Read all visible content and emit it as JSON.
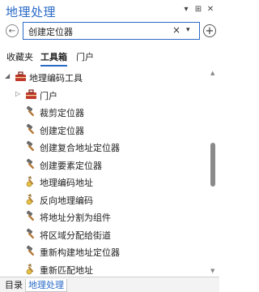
{
  "window": {
    "title": "地理处理",
    "options_icon": "▾",
    "pin_icon": "⊞",
    "close_icon": "✕"
  },
  "search": {
    "value": "创建定位器",
    "clear": "×",
    "dropdown": "▾"
  },
  "tabs": [
    {
      "label": "收藏夹",
      "active": false
    },
    {
      "label": "工具箱",
      "active": true
    },
    {
      "label": "门户",
      "active": false
    }
  ],
  "tree": [
    {
      "label": "地理编码工具",
      "icon": "toolbox-icon",
      "level": 0,
      "arrow": "◢"
    },
    {
      "label": "门户",
      "icon": "toolbox-icon",
      "level": 1,
      "arrow": "▷"
    },
    {
      "label": "裁剪定位器",
      "icon": "hammer-icon",
      "level": 2
    },
    {
      "label": "创建定位器",
      "icon": "hammer-icon",
      "level": 2
    },
    {
      "label": "创建复合地址定位器",
      "icon": "hammer-icon",
      "level": 2
    },
    {
      "label": "创建要素定位器",
      "icon": "hammer-icon",
      "level": 2
    },
    {
      "label": "地理编码地址",
      "icon": "geocode-icon",
      "level": 2
    },
    {
      "label": "反向地理编码",
      "icon": "geocode-icon",
      "level": 2
    },
    {
      "label": "将地址分割为组件",
      "icon": "hammer-icon",
      "level": 2
    },
    {
      "label": "将区域分配给街道",
      "icon": "hammer-icon",
      "level": 2
    },
    {
      "label": "重新构建地址定位器",
      "icon": "hammer-icon",
      "level": 2
    },
    {
      "label": "重新匹配地址",
      "icon": "geocode-icon",
      "level": 2
    }
  ],
  "bottom_tabs": [
    {
      "label": "目录",
      "active": false
    },
    {
      "label": "地理处理",
      "active": true
    }
  ],
  "colors": {
    "accent": "#2a6ac7",
    "hammer_head": "#6b6b6b",
    "handle": "#b57b3c",
    "toolbox_red": "#c0392b"
  }
}
